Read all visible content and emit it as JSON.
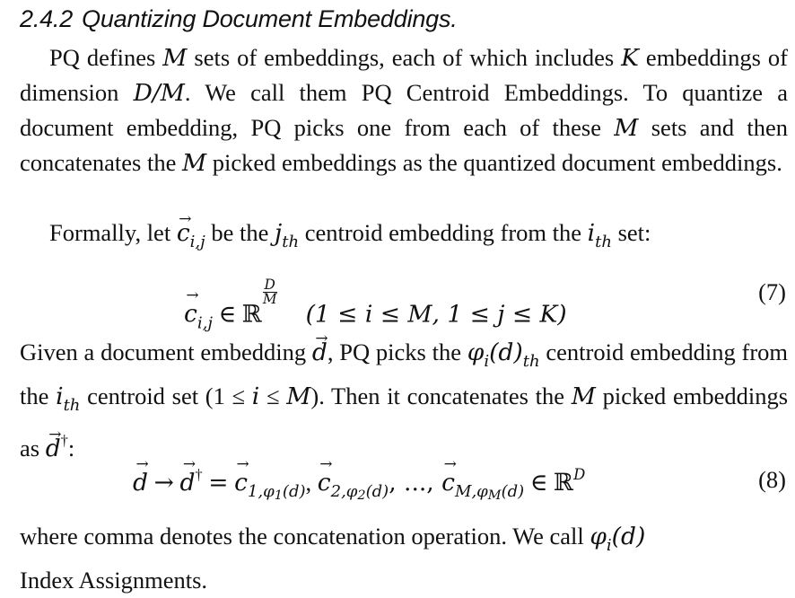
{
  "section": {
    "number": "2.4.2",
    "title": "Quantizing Document Embeddings."
  },
  "para1": {
    "t1": "PQ defines ",
    "t2": " sets of embeddings, each of which includes ",
    "t3": " embeddings of dimension ",
    "t4": ". We call them PQ Centroid Embeddings. To quantize a document embedding, PQ picks one from each of these ",
    "t5": " sets and then concatenates the ",
    "t6": " picked embeddings as the quantized document embeddings."
  },
  "para2": {
    "t1": "Formally, let ",
    "t2": " be the ",
    "t3": " centroid embedding from the ",
    "t4": " set:"
  },
  "eq7": {
    "lhs": "c",
    "lhs_sub": "i,j",
    "in": "∈",
    "set": "ℝ",
    "frac_num": "D",
    "frac_den": "M",
    "cond": "(1 ≤ i ≤ M, 1 ≤ j ≤ K)",
    "number": "(7)"
  },
  "para3": {
    "t1": "Given a document embedding ",
    "t2": ", PQ picks the ",
    "t3": " centroid embedding from the ",
    "t4": " centroid set (1 ≤ ",
    "t5": " ≤ ",
    "t6": "). Then it concatenates the ",
    "t7": " picked embeddings as ",
    "t8": ":"
  },
  "eq8": {
    "d": "d",
    "arrow": "→",
    "dagger": "†",
    "equals": "=",
    "c": "c",
    "sub1": "1,φ",
    "sub1b": "1",
    "sub1c": "(d)",
    "sub2": "2,φ",
    "sub2b": "2",
    "sub2c": "(d)",
    "ellipsis": ", ..., ",
    "subM": "M,φ",
    "subMb": "M",
    "subMc": "(d)",
    "in": "∈",
    "set": "ℝ",
    "sup": "D",
    "number": "(8)"
  },
  "para4": {
    "t1": "where comma denotes the concatenation operation. We call ",
    "t2": " Index Assignments."
  },
  "sym": {
    "M": "M",
    "K": "K",
    "D_over_M": "D/M",
    "c": "c",
    "ij": "i,j",
    "j": "j",
    "i": "i",
    "th": "th",
    "d": "d",
    "phi_i_d": "φ",
    "phi_sub": "i",
    "phi_arg": "(d)",
    "dagger": "†"
  }
}
